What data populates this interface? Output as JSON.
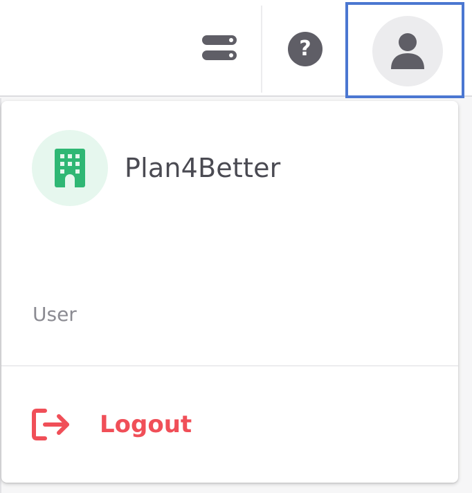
{
  "header": {
    "layers_icon": "stacked-layers-icon",
    "help_icon": "question-circle-icon",
    "help_glyph": "?",
    "avatar_icon": "user-icon"
  },
  "menu": {
    "organization": {
      "icon": "building-icon",
      "name": "Plan4Better"
    },
    "role_label": "User",
    "logout": {
      "icon": "logout-arrow-icon",
      "label": "Logout"
    }
  },
  "colors": {
    "accent_selection": "#4b77d1",
    "org_icon_green": "#2fb774",
    "org_avatar_bg": "#e6f7ee",
    "logout_red": "#f04f58",
    "icon_gray": "#5f5e66"
  }
}
